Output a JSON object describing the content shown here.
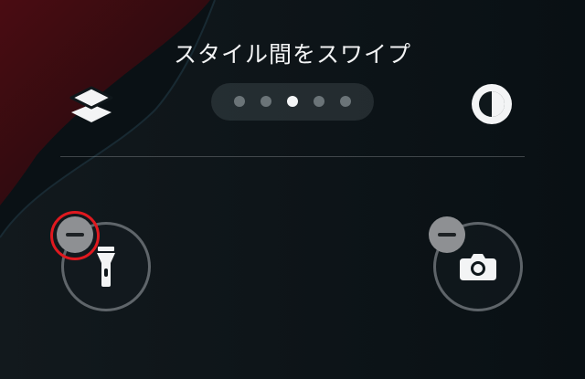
{
  "header": {
    "title": "スタイル間をスワイプ"
  },
  "toolbar": {
    "left_icon": "stack-layers-icon",
    "right_icon": "contrast-circle-icon"
  },
  "page_indicator": {
    "total": 5,
    "active_index": 2
  },
  "controls": {
    "left": {
      "icon": "flashlight-icon",
      "remove_icon": "minus-icon"
    },
    "right": {
      "icon": "camera-icon",
      "remove_icon": "minus-icon"
    }
  },
  "colors": {
    "highlight": "#e0191f",
    "remove_badge": "#8e9093",
    "active_dot": "#f4f5f6",
    "inactive_dot": "#6b7478"
  }
}
